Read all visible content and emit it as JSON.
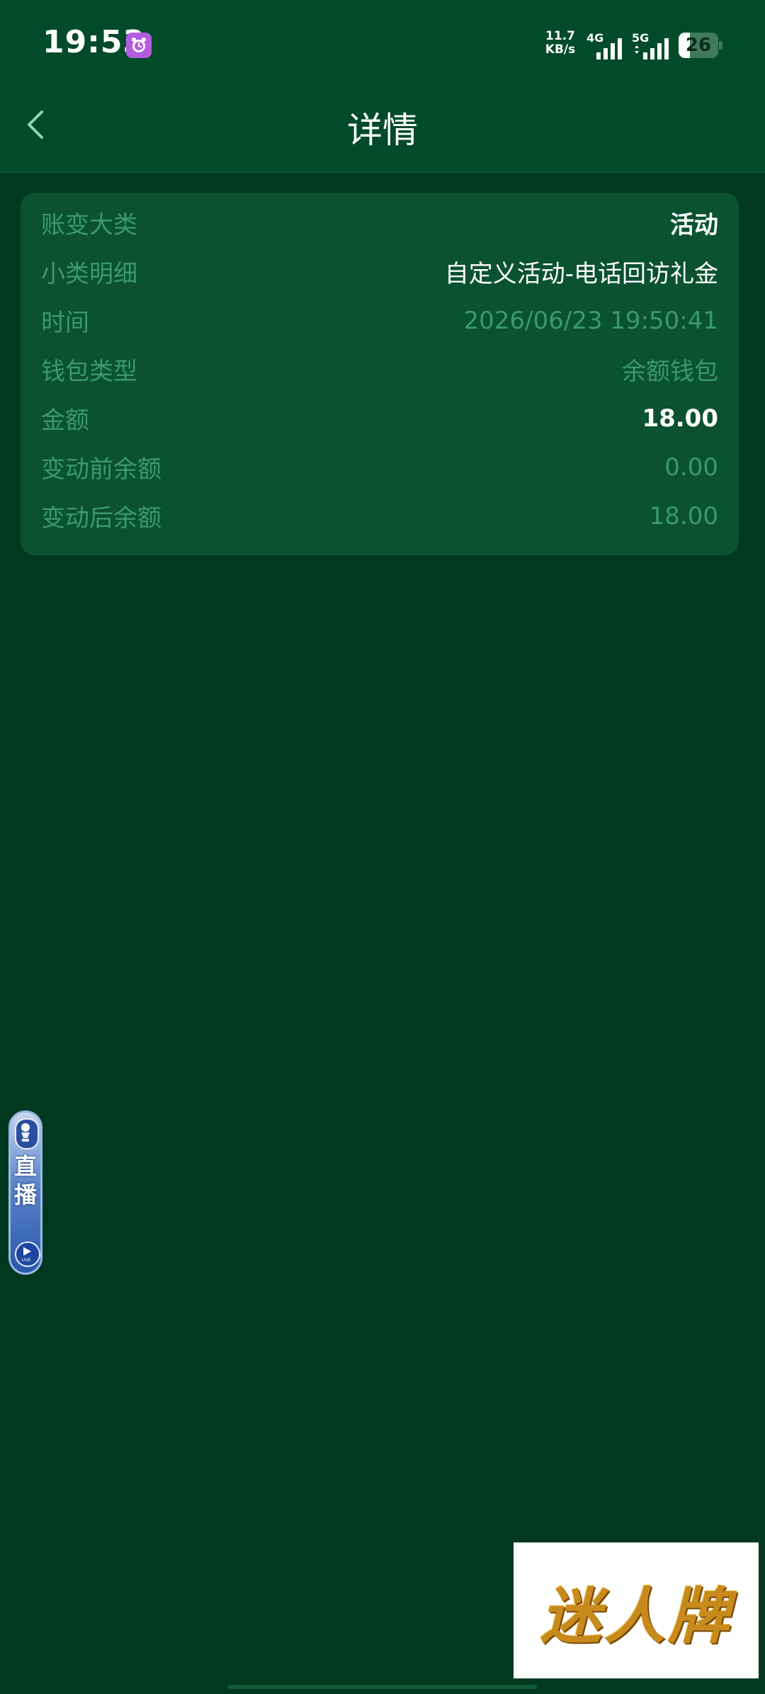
{
  "status_bar": {
    "time": "19:53",
    "net_speed_value": "11.7",
    "net_speed_unit": "KB/s",
    "signal_1_label": "4G",
    "signal_2_label": "5G",
    "battery_level": "26"
  },
  "header": {
    "title": "详情"
  },
  "details": [
    {
      "label": "账变大类",
      "value": "活动"
    },
    {
      "label": "小类明细",
      "value": "自定义活动-电话回访礼金"
    },
    {
      "label": "时间",
      "value": "2026/06/23 19:50:41"
    },
    {
      "label": "钱包类型",
      "value": "余额钱包"
    },
    {
      "label": "金额",
      "value": "18.00"
    },
    {
      "label": "变动前余额",
      "value": "0.00"
    },
    {
      "label": "变动后余额",
      "value": "18.00"
    }
  ],
  "floating_live": {
    "label_line1": "直",
    "label_line2": "播",
    "badge": "LIVE"
  },
  "brand_banner": {
    "text": "迷人牌"
  },
  "colors": {
    "top_bar": "#014a2a",
    "background": "#00391f",
    "card": "#0a5230",
    "muted_text": "#3b9a6a",
    "accent_white": "#ffffff"
  }
}
